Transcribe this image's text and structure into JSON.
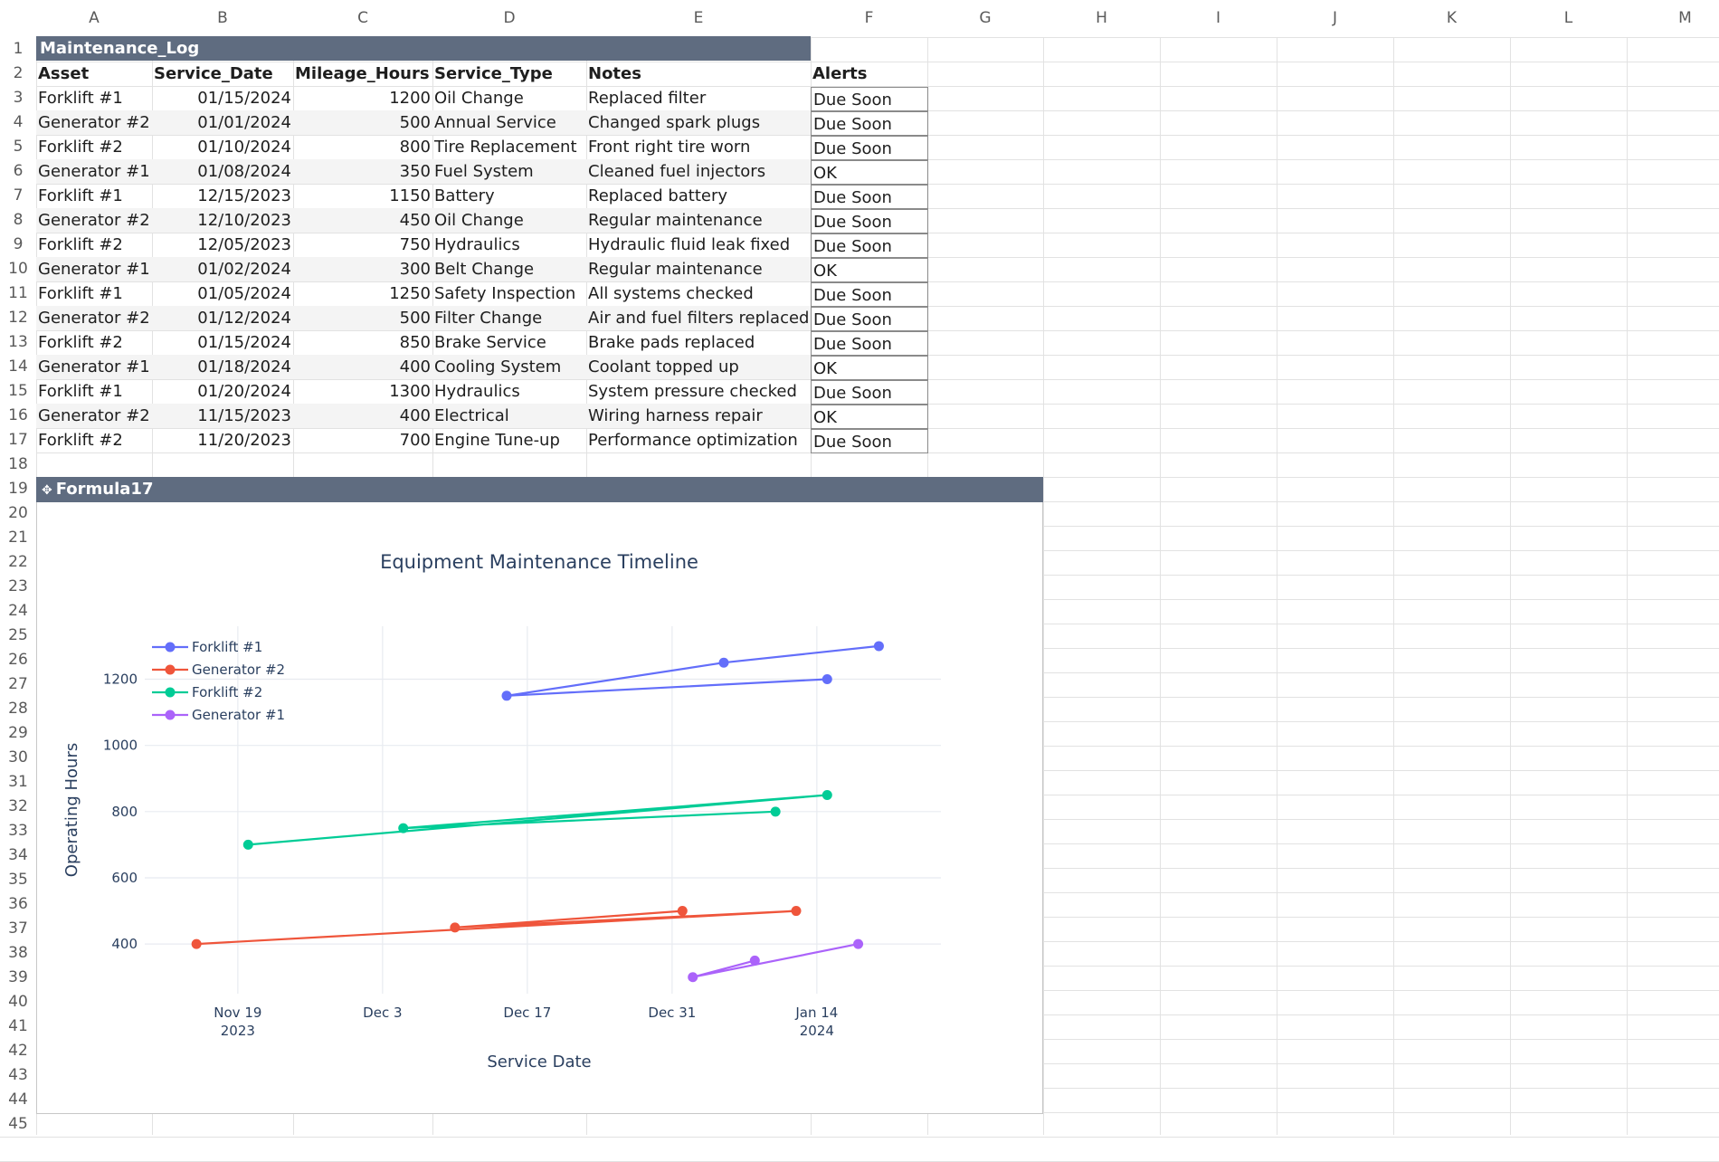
{
  "columns": [
    "A",
    "B",
    "C",
    "D",
    "E",
    "F",
    "G",
    "H",
    "I",
    "J",
    "K",
    "L",
    "M"
  ],
  "table": {
    "title": "Maintenance_Log",
    "headers": [
      "Asset",
      "Service_Date",
      "Mileage_Hours",
      "Service_Type",
      "Notes",
      "Alerts"
    ],
    "rows": [
      [
        "Forklift #1",
        "01/15/2024",
        "1200",
        "Oil Change",
        "Replaced filter",
        "Due Soon"
      ],
      [
        "Generator #2",
        "01/01/2024",
        "500",
        "Annual Service",
        "Changed spark plugs",
        "Due Soon"
      ],
      [
        "Forklift #2",
        "01/10/2024",
        "800",
        "Tire Replacement",
        "Front right tire worn",
        "Due Soon"
      ],
      [
        "Generator #1",
        "01/08/2024",
        "350",
        "Fuel System",
        "Cleaned fuel injectors",
        "OK"
      ],
      [
        "Forklift #1",
        "12/15/2023",
        "1150",
        "Battery",
        "Replaced battery",
        "Due Soon"
      ],
      [
        "Generator #2",
        "12/10/2023",
        "450",
        "Oil Change",
        "Regular maintenance",
        "Due Soon"
      ],
      [
        "Forklift #2",
        "12/05/2023",
        "750",
        "Hydraulics",
        "Hydraulic fluid leak fixed",
        "Due Soon"
      ],
      [
        "Generator #1",
        "01/02/2024",
        "300",
        "Belt Change",
        "Regular maintenance",
        "OK"
      ],
      [
        "Forklift #1",
        "01/05/2024",
        "1250",
        "Safety Inspection",
        "All systems checked",
        "Due Soon"
      ],
      [
        "Generator #2",
        "01/12/2024",
        "500",
        "Filter Change",
        "Air and fuel filters replaced",
        "Due Soon"
      ],
      [
        "Forklift #2",
        "01/15/2024",
        "850",
        "Brake Service",
        "Brake pads replaced",
        "Due Soon"
      ],
      [
        "Generator #1",
        "01/18/2024",
        "400",
        "Cooling System",
        "Coolant topped up",
        "OK"
      ],
      [
        "Forklift #1",
        "01/20/2024",
        "1300",
        "Hydraulics",
        "System pressure checked",
        "Due Soon"
      ],
      [
        "Generator #2",
        "11/15/2023",
        "400",
        "Electrical",
        "Wiring harness repair",
        "OK"
      ],
      [
        "Forklift #2",
        "11/20/2023",
        "700",
        "Engine Tune-up",
        "Performance optimization",
        "Due Soon"
      ]
    ]
  },
  "chart_widget": {
    "title": "Formula17",
    "icon": "move-icon"
  },
  "chart_data": {
    "type": "line",
    "title": "Equipment Maintenance Timeline",
    "xlabel": "Service Date",
    "ylabel": "Operating Hours",
    "xlim": [
      "2023-11-10",
      "2024-01-26"
    ],
    "ylim": [
      250,
      1360
    ],
    "x_ticks": [
      {
        "date": "2023-11-19",
        "label": "Nov 19",
        "sub": "2023"
      },
      {
        "date": "2023-12-03",
        "label": "Dec 3",
        "sub": ""
      },
      {
        "date": "2023-12-17",
        "label": "Dec 17",
        "sub": ""
      },
      {
        "date": "2023-12-31",
        "label": "Dec 31",
        "sub": ""
      },
      {
        "date": "2024-01-14",
        "label": "Jan 14",
        "sub": "2024"
      }
    ],
    "y_ticks": [
      400,
      600,
      800,
      1000,
      1200
    ],
    "grid": true,
    "legend": "top-left",
    "series": [
      {
        "name": "Forklift #1",
        "color": "#636efa",
        "points": [
          [
            "2024-01-15",
            1200
          ],
          [
            "2023-12-15",
            1150
          ],
          [
            "2024-01-05",
            1250
          ],
          [
            "2024-01-20",
            1300
          ]
        ]
      },
      {
        "name": "Generator #2",
        "color": "#ef553b",
        "points": [
          [
            "2024-01-01",
            500
          ],
          [
            "2023-12-10",
            450
          ],
          [
            "2024-01-12",
            500
          ],
          [
            "2023-11-15",
            400
          ]
        ]
      },
      {
        "name": "Forklift #2",
        "color": "#00cc96",
        "points": [
          [
            "2024-01-10",
            800
          ],
          [
            "2023-12-05",
            750
          ],
          [
            "2024-01-15",
            850
          ],
          [
            "2023-11-20",
            700
          ]
        ]
      },
      {
        "name": "Generator #1",
        "color": "#ab63fa",
        "points": [
          [
            "2024-01-08",
            350
          ],
          [
            "2024-01-02",
            300
          ],
          [
            "2024-01-18",
            400
          ]
        ]
      }
    ]
  }
}
